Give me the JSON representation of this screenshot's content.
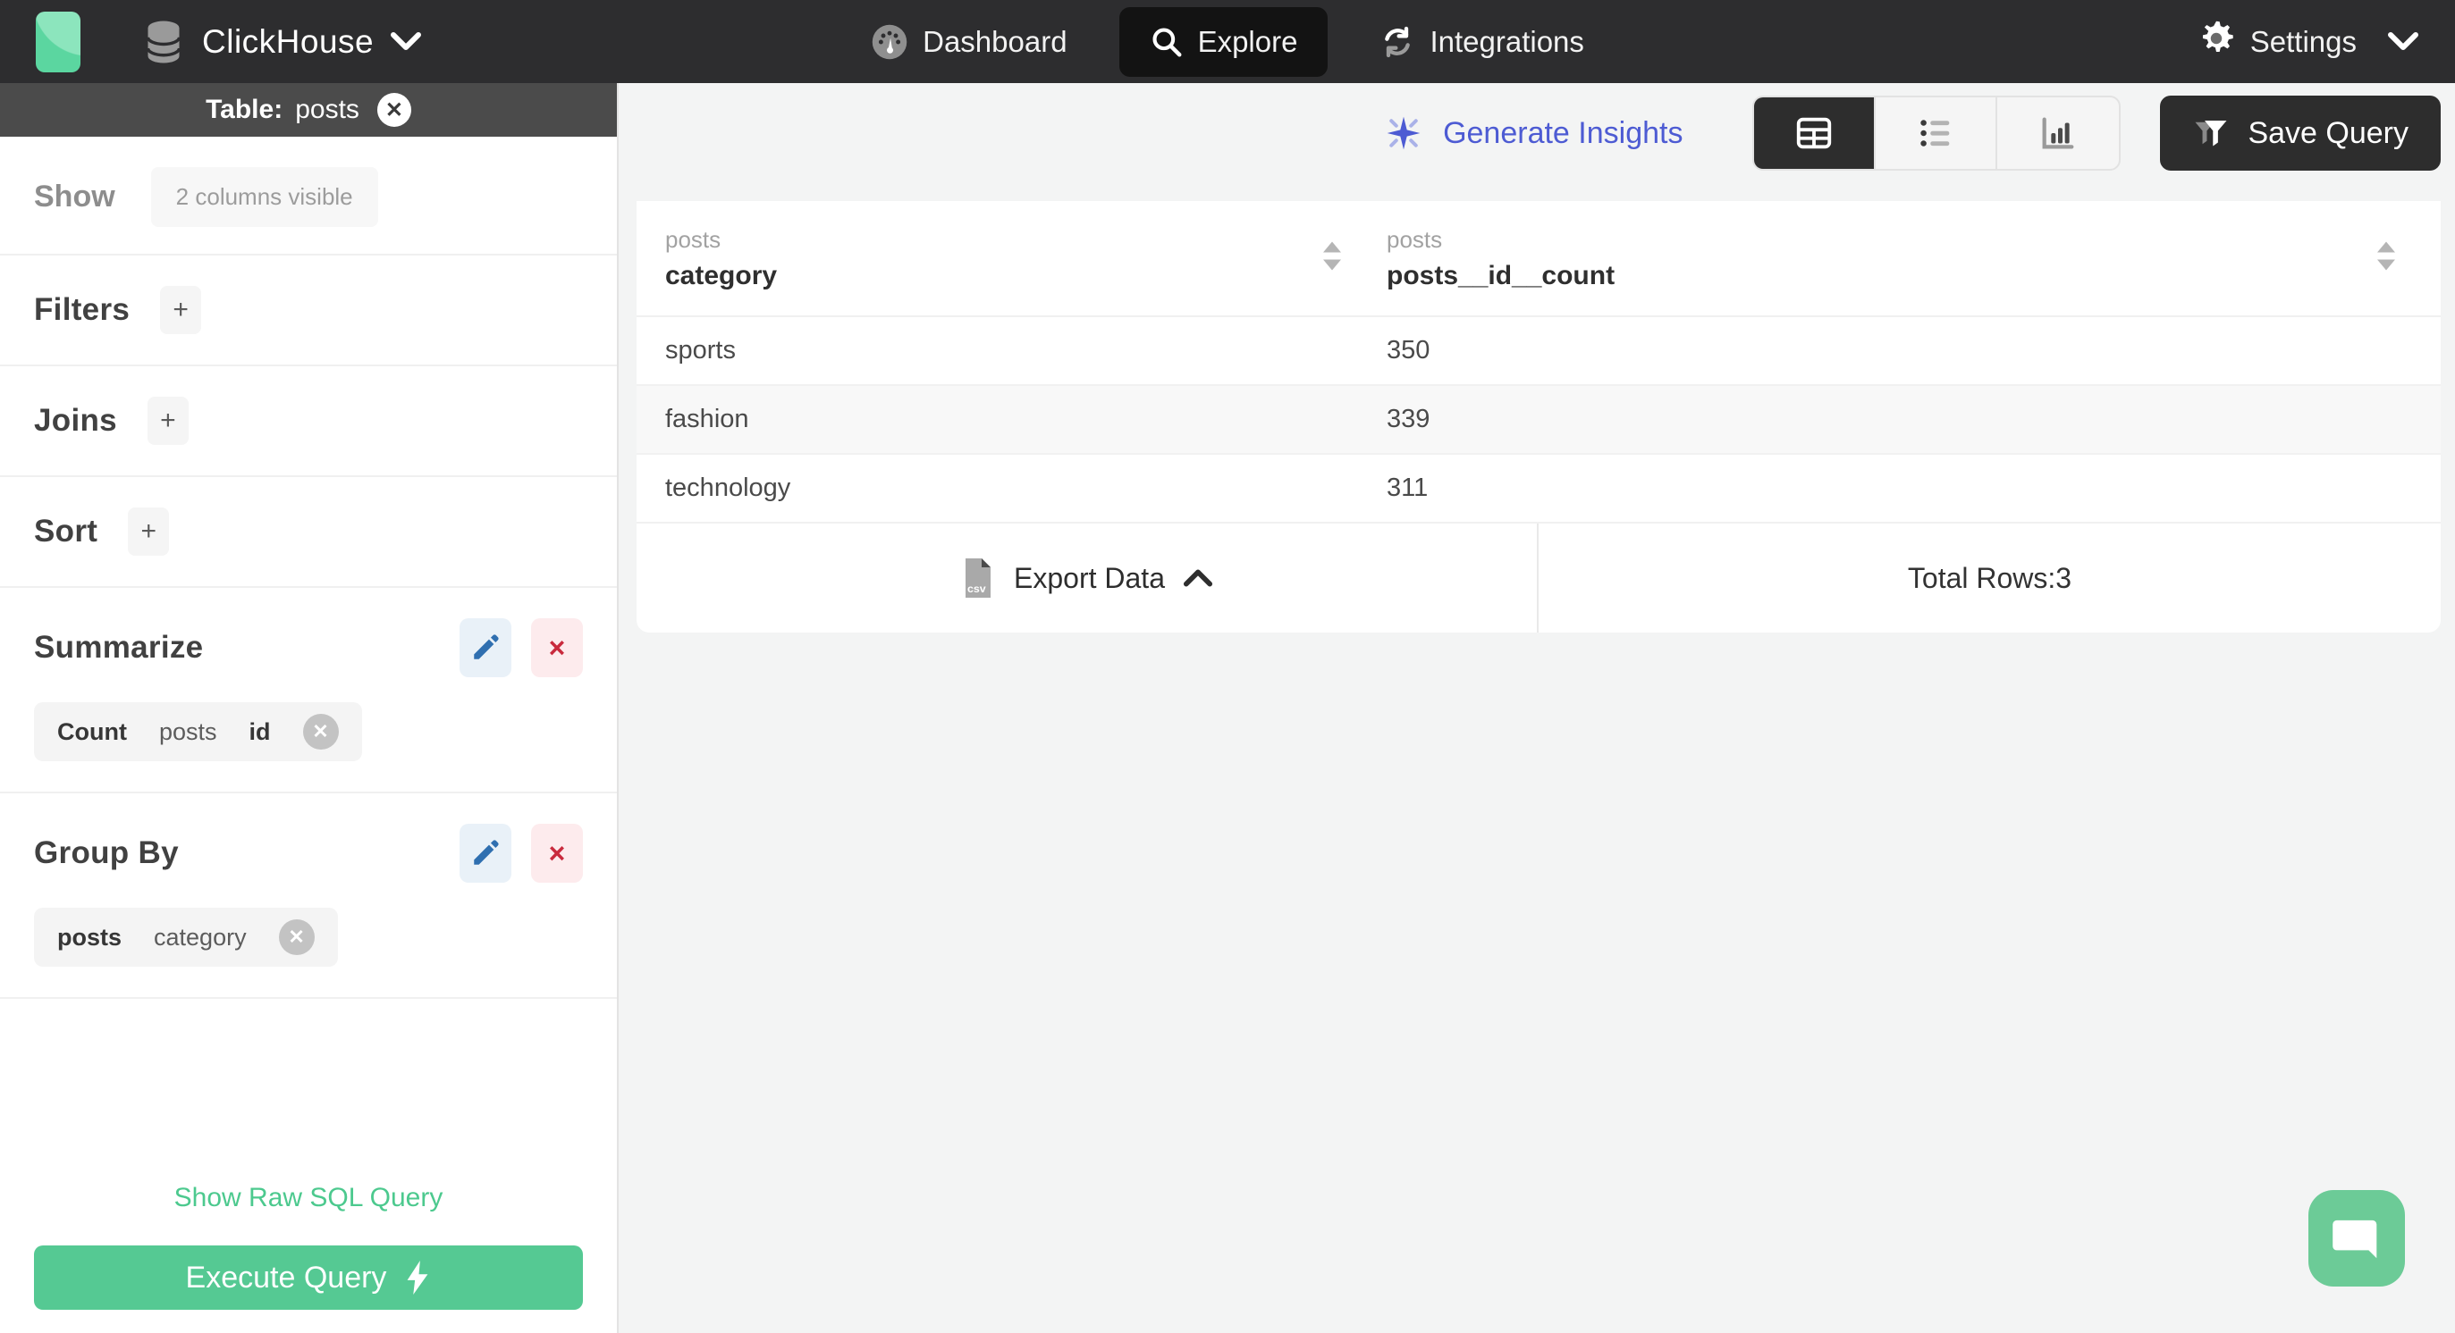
{
  "colors": {
    "nav_bg": "#2d2d2f",
    "accent_green": "#55c993",
    "link_green": "#4cc98e",
    "insights_indigo": "#4d5bd3",
    "edit_blue": "#2f6fb0",
    "delete_red": "#c92a3d",
    "dark_button": "#2d2d2d"
  },
  "nav": {
    "brand": "ClickHouse",
    "items": [
      {
        "label": "Dashboard"
      },
      {
        "label": "Explore"
      },
      {
        "label": "Integrations"
      }
    ],
    "settings_label": "Settings"
  },
  "sidebar": {
    "table_bar": {
      "prefix": "Table:",
      "table_name": "posts"
    },
    "show": {
      "label": "Show",
      "chip": "2 columns visible"
    },
    "sections": [
      {
        "label": "Filters",
        "add_label": "+"
      },
      {
        "label": "Joins",
        "add_label": "+"
      },
      {
        "label": "Sort",
        "add_label": "+"
      }
    ],
    "summarize": {
      "title": "Summarize",
      "chip": {
        "op": "Count",
        "table": "posts",
        "field": "id"
      }
    },
    "group_by": {
      "title": "Group By",
      "chip": {
        "table": "posts",
        "field": "category"
      }
    },
    "raw_sql_label": "Show Raw SQL Query",
    "execute_label": "Execute Query",
    "delete_glyph": "×",
    "close_glyph": "✕",
    "chip_close_glyph": "✕"
  },
  "main": {
    "insights_label": "Generate Insights",
    "save_label": "Save Query",
    "table": {
      "columns": [
        {
          "group": "posts",
          "name": "category"
        },
        {
          "group": "posts",
          "name": "posts__id__count"
        }
      ],
      "rows": [
        {
          "category": "sports",
          "count": "350"
        },
        {
          "category": "fashion",
          "count": "339"
        },
        {
          "category": "technology",
          "count": "311"
        }
      ],
      "footer": {
        "export_label": "Export Data",
        "total_label": "Total Rows:3"
      }
    }
  }
}
